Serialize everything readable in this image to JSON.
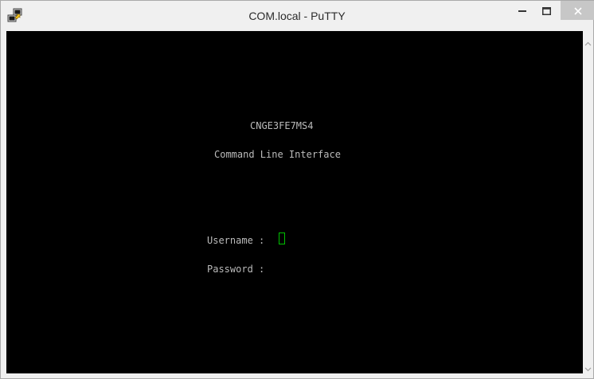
{
  "window": {
    "title": "COM.local - PuTTY"
  },
  "icons": {
    "app": "putty-icon",
    "minimize": "minimize-icon",
    "maximize": "maximize-icon",
    "close": "close-icon",
    "scroll_up": "scroll-up-arrow-icon",
    "scroll_down": "scroll-down-arrow-icon"
  },
  "terminal": {
    "device_name": "CNGE3FE7MS4",
    "subtitle": "Command Line Interface",
    "username_prompt": "Username :",
    "password_prompt": "Password :",
    "username_value": "",
    "password_value": ""
  },
  "colors": {
    "terminal_background": "#000000",
    "terminal_text": "#bbbbbb",
    "cursor": "#00c000"
  }
}
